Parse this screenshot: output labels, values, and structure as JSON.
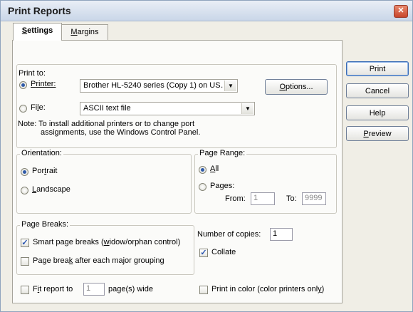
{
  "window": {
    "title": "Print Reports",
    "close_label": "✕"
  },
  "tabs": [
    {
      "label": "Settings",
      "accel": "S",
      "rest": "ettings"
    },
    {
      "label": "Margins",
      "accel": "M",
      "rest": "argins"
    }
  ],
  "buttons": {
    "print": "Print",
    "cancel": "Cancel",
    "help": "Help",
    "preview_accel": "P",
    "preview_rest": "review"
  },
  "print_to": {
    "heading": "Print to:",
    "printer_label_accel": "P",
    "printer_label_rest": "rinter:",
    "printer_value": "Brother HL-5240 series (Copy 1) on US…",
    "options_accel": "O",
    "options_rest": "ptions...",
    "file_label_pre": "Fi",
    "file_label_accel": "l",
    "file_label_post": "e:",
    "file_value": "ASCII text file",
    "note_line1": "Note: To install additional printers or to change port",
    "note_line2": "assignments, use the Windows Control Panel."
  },
  "orientation": {
    "legend": "Orientation:",
    "portrait_pre": "Por",
    "portrait_accel": "t",
    "portrait_post": "rait",
    "landscape_accel": "L",
    "landscape_rest": "andscape",
    "selected": "portrait"
  },
  "page_range": {
    "legend": "Page Range:",
    "all_accel": "A",
    "all_rest": "ll",
    "pages_pre": "Pa",
    "pages_accel": "g",
    "pages_post": "es:",
    "from_label": "From:",
    "from_value": "1",
    "to_label": "To:",
    "to_value": "9999",
    "selected": "all"
  },
  "page_breaks": {
    "legend": "Page Breaks:",
    "smart_pre": "Smart page breaks (",
    "smart_accel": "w",
    "smart_post": "idow/orphan control)",
    "smart_checked": true,
    "major_pre": "Page brea",
    "major_accel": "k",
    "major_post": " after each major grouping",
    "major_checked": false
  },
  "copies": {
    "label": "Number of copies:",
    "value": "1",
    "collate_label": "Collate",
    "collate_checked": true
  },
  "fit": {
    "pre": "F",
    "accel": "i",
    "post": "t report to",
    "value": "1",
    "suffix": "page(s) wide",
    "checked": false
  },
  "color": {
    "pre": "Print in color (color printers onl",
    "accel": "y",
    "post": ")",
    "checked": false
  },
  "check_glyph": "✓",
  "arrow_glyph": "▼"
}
